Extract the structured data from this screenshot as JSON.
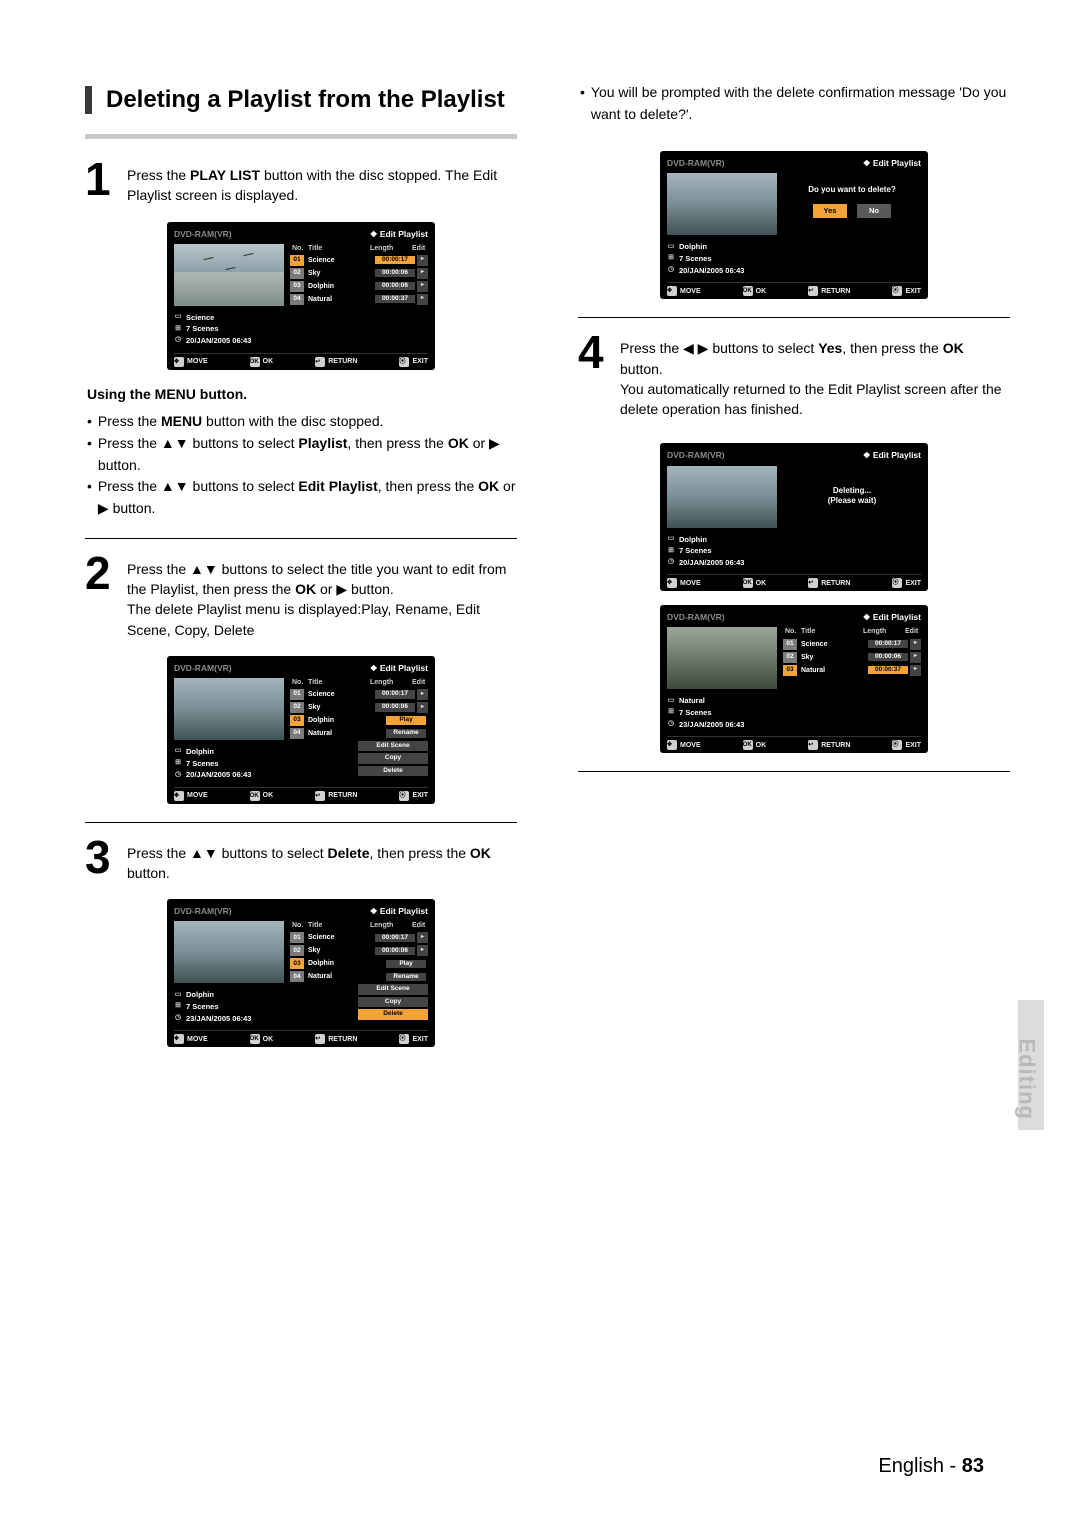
{
  "section_title": "Deleting a Playlist from the Playlist",
  "side_label": "Editing",
  "footer": {
    "language": "English - ",
    "page": "83"
  },
  "step1": {
    "text_a": "Press the ",
    "bold1": "PLAY LIST",
    "text_b": " button with the disc stopped. The Edit Playlist screen is displayed."
  },
  "menu_heading": "Using the MENU button.",
  "menu_bullets": {
    "b1a": "Press the ",
    "b1b": "MENU",
    "b1c": " button with the disc stopped.",
    "b2a": "Press the ▲▼ buttons to select ",
    "b2b": "Playlist",
    "b2c": ", then press the ",
    "b2d": "OK",
    "b2e": " or ▶ button.",
    "b3a": "Press the ▲▼ buttons to select ",
    "b3b": "Edit Playlist",
    "b3c": ", then press the ",
    "b3d": "OK",
    "b3e": " or ▶ button."
  },
  "step2": {
    "a": "Press the ▲▼ buttons to select the title you want to edit from the Playlist, then press the ",
    "b": "OK",
    "c": " or ▶ button.",
    "d": "The delete Playlist menu is displayed:Play, Rename, Edit Scene, Copy, Delete"
  },
  "step3": {
    "a": "Press the ▲▼ buttons to select ",
    "b": "Delete",
    "c": ", then press the ",
    "d": "OK",
    "e": " button."
  },
  "continue_bullet": {
    "a": "You will be prompted with the delete confirmation message 'Do you want to delete?'."
  },
  "step4": {
    "a": "Press the ◀ ▶ buttons to select ",
    "b": "Yes",
    "c": ", then press the ",
    "d": "OK",
    "e": " button.",
    "f": "You automatically returned to the Edit Playlist screen after the delete operation has finished."
  },
  "osd_common": {
    "disc": "DVD-RAM(VR)",
    "mode_prefix": "❖ ",
    "mode": "Edit Playlist",
    "hd_no": "No.",
    "hd_title": "Title",
    "hd_len": "Length",
    "hd_edit": "Edit",
    "ftr_move": "MOVE",
    "ftr_ok": "OK",
    "ftr_return": "RETURN",
    "ftr_exit": "EXIT",
    "scenes": "7 Scenes"
  },
  "osd1": {
    "meta_title": "Science",
    "meta_date": "20/JAN/2005 06:43",
    "rows": {
      "r0": {
        "no": "01",
        "title": "Science",
        "len": "00:00:17"
      },
      "r1": {
        "no": "02",
        "title": "Sky",
        "len": "00:00:06"
      },
      "r2": {
        "no": "03",
        "title": "Dolphin",
        "len": "00:00:06"
      },
      "r3": {
        "no": "04",
        "title": "Natural",
        "len": "00:00:37"
      }
    }
  },
  "osd2": {
    "meta_title": "Dolphin",
    "meta_date": "20/JAN/2005 06:43",
    "rows": {
      "r0": {
        "no": "01",
        "title": "Science",
        "len": "00:00:17"
      },
      "r1": {
        "no": "02",
        "title": "Sky",
        "len": "00:00:06"
      },
      "r2": {
        "no": "03",
        "title": "Dolphin",
        "len": "Play"
      },
      "r3": {
        "no": "04",
        "title": "Natural",
        "len": "Rename"
      }
    },
    "menu": {
      "m0": "Edit Scene",
      "m1": "Copy",
      "m2": "Delete"
    }
  },
  "osd3": {
    "meta_title": "Dolphin",
    "meta_date": "23/JAN/2005 06:43",
    "rows": {
      "r0": {
        "no": "01",
        "title": "Science",
        "len": "00:00:17"
      },
      "r1": {
        "no": "02",
        "title": "Sky",
        "len": "00:00:06"
      },
      "r2": {
        "no": "03",
        "title": "Dolphin",
        "len": "Play"
      },
      "r3": {
        "no": "04",
        "title": "Natural",
        "len": "Rename"
      }
    },
    "menu": {
      "m0": "Edit Scene",
      "m1": "Copy",
      "m2": "Delete"
    }
  },
  "osd4": {
    "meta_title": "Dolphin",
    "meta_date": "20/JAN/2005 06:43",
    "question": "Do you want to delete?",
    "yes": "Yes",
    "no": "No"
  },
  "osd5": {
    "meta_title": "Dolphin",
    "meta_date": "20/JAN/2005 06:43",
    "line1": "Deleting...",
    "line2": "(Please wait)"
  },
  "osd6": {
    "meta_title": "Natural",
    "meta_date": "23/JAN/2005 06:43",
    "rows": {
      "r0": {
        "no": "01",
        "title": "Science",
        "len": "00:00:17"
      },
      "r1": {
        "no": "02",
        "title": "Sky",
        "len": "00:00:06"
      },
      "r2": {
        "no": "03",
        "title": "Natural",
        "len": "00:00:37"
      }
    }
  }
}
